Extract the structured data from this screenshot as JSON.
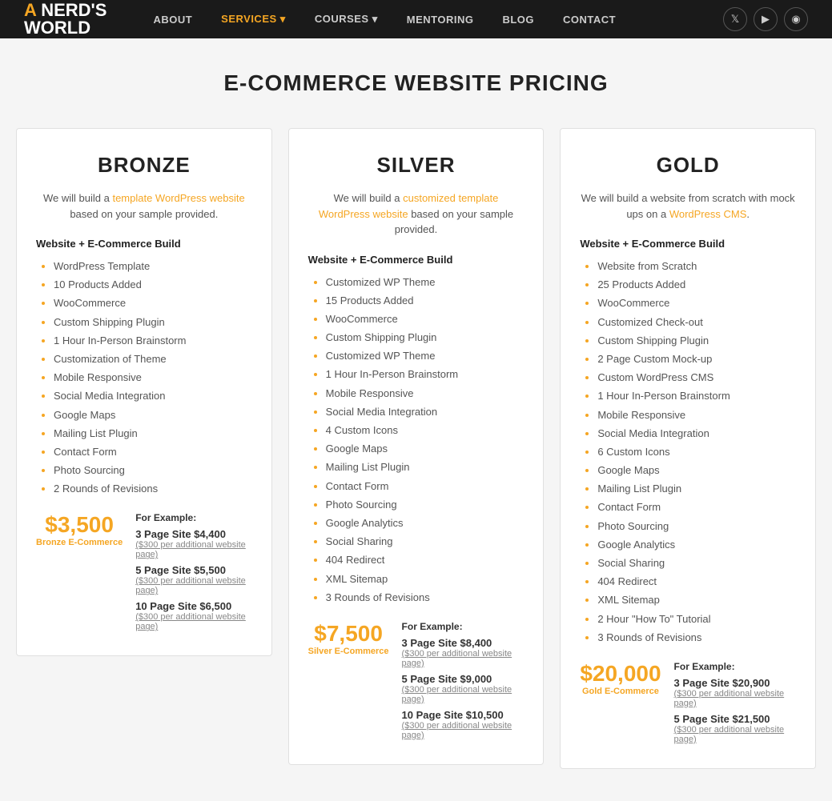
{
  "nav": {
    "logo_line1": "A NERD'S",
    "logo_line2": "WORLD",
    "links": [
      {
        "label": "ABOUT",
        "active": false
      },
      {
        "label": "SERVICES ▾",
        "active": true
      },
      {
        "label": "COURSES ▾",
        "active": false
      },
      {
        "label": "MENTORING",
        "active": false
      },
      {
        "label": "BLOG",
        "active": false
      },
      {
        "label": "CONTACT",
        "active": false
      }
    ],
    "social": [
      "𝕏",
      "▶",
      "📷"
    ]
  },
  "page": {
    "title": "E-COMMERCE WEBSITE PRICING"
  },
  "plans": [
    {
      "id": "bronze",
      "title": "BRONZE",
      "description": "We will build a template WordPress website based on your sample provided.",
      "section_header": "Website + E-Commerce Build",
      "features": [
        "WordPress Template",
        "10 Products Added",
        "WooCommerce",
        "Custom Shipping Plugin",
        "1 Hour In-Person Brainstorm",
        "Customization of Theme",
        "Mobile Responsive",
        "Social Media Integration",
        "Google Maps",
        "Mailing List Plugin",
        "Contact Form",
        "Photo Sourcing",
        "2 Rounds of Revisions"
      ],
      "price": "$3,500",
      "price_label": "Bronze E-Commerce",
      "example_header": "For Example:",
      "examples": [
        {
          "label": "3 Page Site $4,400",
          "sub": "($300 per additional website page)"
        },
        {
          "label": "5 Page Site $5,500",
          "sub": "($300 per additional website page)"
        },
        {
          "label": "10 Page Site $6,500",
          "sub": "($300 per additional website page)"
        }
      ]
    },
    {
      "id": "silver",
      "title": "SILVER",
      "description": "We will build a customized template WordPress website based on your sample provided.",
      "section_header": "Website + E-Commerce Build",
      "features": [
        "Customized WP Theme",
        "15 Products Added",
        "WooCommerce",
        "Custom Shipping Plugin",
        "Customized WP Theme",
        "1 Hour In-Person Brainstorm",
        "Mobile Responsive",
        "Social Media Integration",
        "4 Custom Icons",
        "Google Maps",
        "Mailing List Plugin",
        "Contact Form",
        "Photo Sourcing",
        "Google Analytics",
        "Social Sharing",
        "404 Redirect",
        "XML Sitemap",
        "3 Rounds of Revisions"
      ],
      "price": "$7,500",
      "price_label": "Silver E-Commerce",
      "example_header": "For Example:",
      "examples": [
        {
          "label": "3 Page Site $8,400",
          "sub": "($300 per additional website page)"
        },
        {
          "label": "5 Page Site $9,000",
          "sub": "($300 per additional website page)"
        },
        {
          "label": "10 Page Site $10,500",
          "sub": "($300 per additional website page)"
        }
      ]
    },
    {
      "id": "gold",
      "title": "GOLD",
      "description": "We will build a website from scratch with mock ups on a WordPress CMS.",
      "section_header": "Website + E-Commerce Build",
      "features": [
        "Website from Scratch",
        "25 Products Added",
        "WooCommerce",
        "Customized Check-out",
        "Custom Shipping Plugin",
        "2 Page Custom Mock-up",
        "Custom WordPress CMS",
        "1 Hour In-Person Brainstorm",
        "Mobile Responsive",
        "Social Media Integration",
        "6 Custom Icons",
        "Google Maps",
        "Mailing List Plugin",
        "Contact Form",
        "Photo Sourcing",
        "Google Analytics",
        "Social Sharing",
        "404 Redirect",
        "XML Sitemap",
        "2 Hour \"How To\" Tutorial",
        "3 Rounds of Revisions"
      ],
      "price": "$20,000",
      "price_label": "Gold E-Commerce",
      "example_header": "For Example:",
      "examples": [
        {
          "label": "3 Page Site $20,900",
          "sub": "($300 per additional website page)"
        },
        {
          "label": "5 Page Site $21,500",
          "sub": "($300 per additional website page)"
        }
      ]
    }
  ]
}
